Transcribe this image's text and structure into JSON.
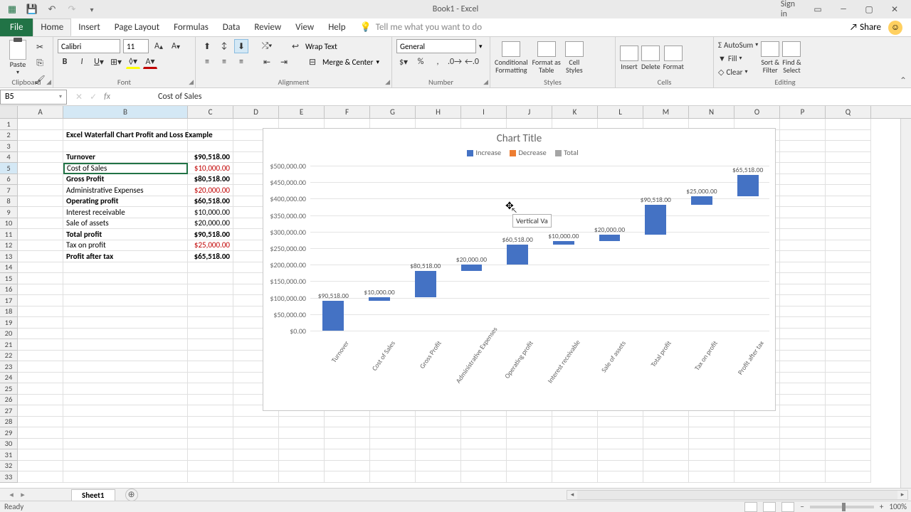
{
  "title": "Book1 - Excel",
  "signin": "Sign in",
  "tabs": [
    "File",
    "Home",
    "Insert",
    "Page Layout",
    "Formulas",
    "Data",
    "Review",
    "View",
    "Help"
  ],
  "tellme": "Tell me what you want to do",
  "share": "Share",
  "ribbon": {
    "paste": "Paste",
    "clipboard": "Clipboard",
    "fontname": "Calibri",
    "fontsize": "11",
    "fontgrp": "Font",
    "wrap": "Wrap Text",
    "merge": "Merge & Center",
    "aligngrp": "Alignment",
    "numfmt": "General",
    "numgrp": "Number",
    "cfmt": "Conditional\nFormatting",
    "fat": "Format as\nTable",
    "cstyles": "Cell\nStyles",
    "stylesgrp": "Styles",
    "insert": "Insert",
    "delete": "Delete",
    "format": "Format",
    "cellsgrp": "Cells",
    "autosum": "AutoSum",
    "fill": "Fill",
    "clear": "Clear",
    "sort": "Sort &\nFilter",
    "find": "Find &\nSelect",
    "editgrp": "Editing"
  },
  "namebox": "B5",
  "formula": "Cost of Sales",
  "cols": [
    "A",
    "B",
    "C",
    "D",
    "E",
    "F",
    "G",
    "H",
    "I",
    "J",
    "K",
    "L",
    "M",
    "N",
    "O",
    "P",
    "Q"
  ],
  "data_title": "Excel Waterfall Chart Profit and Loss Example",
  "table": [
    {
      "label": "Turnover",
      "value": "$90,518.00",
      "bold": true,
      "red": false
    },
    {
      "label": "Cost of Sales",
      "value": "$10,000.00",
      "bold": false,
      "red": true
    },
    {
      "label": "Gross Profit",
      "value": "$80,518.00",
      "bold": true,
      "red": false
    },
    {
      "label": "Administrative Expenses",
      "value": "$20,000.00",
      "bold": false,
      "red": true
    },
    {
      "label": "Operating profit",
      "value": "$60,518.00",
      "bold": true,
      "red": false
    },
    {
      "label": "Interest receivable",
      "value": "$10,000.00",
      "bold": false,
      "red": false
    },
    {
      "label": "Sale of assets",
      "value": "$20,000.00",
      "bold": false,
      "red": false
    },
    {
      "label": "Total profit",
      "value": "$90,518.00",
      "bold": true,
      "red": false
    },
    {
      "label": "Tax on profit",
      "value": "$25,000.00",
      "bold": false,
      "red": true
    },
    {
      "label": "Profit after tax",
      "value": "$65,518.00",
      "bold": true,
      "red": false
    }
  ],
  "chart": {
    "title": "Chart Title",
    "legend": [
      "Increase",
      "Decrease",
      "Total"
    ],
    "legend_colors": [
      "#4472c4",
      "#ed7d31",
      "#a5a5a5"
    ],
    "yticks": [
      {
        "v": 500000,
        "l": "$500,000.00"
      },
      {
        "v": 450000,
        "l": "$450,000.00"
      },
      {
        "v": 400000,
        "l": "$400,000.00"
      },
      {
        "v": 350000,
        "l": "$350,000.00"
      },
      {
        "v": 300000,
        "l": "$300,000.00"
      },
      {
        "v": 250000,
        "l": "$250,000.00"
      },
      {
        "v": 200000,
        "l": "$200,000.00"
      },
      {
        "v": 150000,
        "l": "$150,000.00"
      },
      {
        "v": 100000,
        "l": "$100,000.00"
      },
      {
        "v": 50000,
        "l": "$50,000.00"
      },
      {
        "v": 0,
        "l": "$0.00"
      }
    ],
    "tooltip": "Vertical Va"
  },
  "chart_data": {
    "type": "waterfall",
    "title": "Chart Title",
    "ylabel": "",
    "ylim": [
      0,
      500000
    ],
    "categories": [
      "Turnover",
      "Cost of Sales",
      "Gross Profit",
      "Administrative Expenses",
      "Operating profit",
      "Interest receivable",
      "Sale of assets",
      "Total profit",
      "Tax on profit",
      "Profit after tax"
    ],
    "values": [
      90518,
      10000,
      80518,
      20000,
      60518,
      10000,
      20000,
      90518,
      25000,
      65518
    ],
    "data_labels": [
      "$90,518.00",
      "$10,000.00",
      "$80,518.00",
      "$20,000.00",
      "$60,518.00",
      "$10,000.00",
      "$20,000.00",
      "$90,518.00",
      "$25,000.00",
      "$65,518.00"
    ],
    "bases": [
      0,
      90518,
      100518,
      181036,
      201036,
      261554,
      271554,
      291554,
      382072,
      407072
    ],
    "color": "#4472c4"
  },
  "sheet": "Sheet1",
  "status": "Ready",
  "zoom": "100%"
}
